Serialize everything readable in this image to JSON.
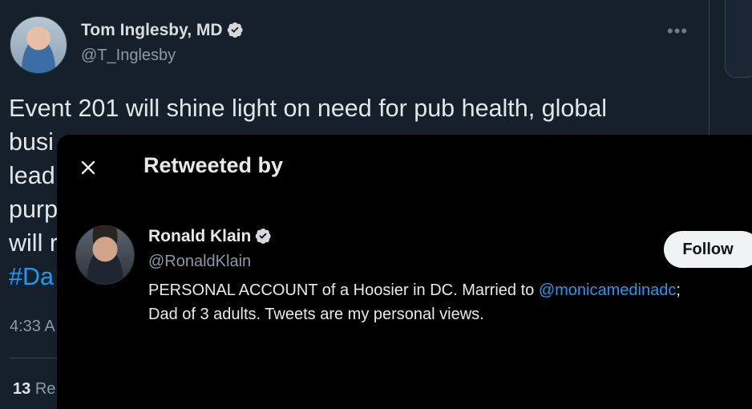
{
  "tweet": {
    "author_name": "Tom Inglesby, MD",
    "author_handle": "@T_Inglesby",
    "text_lines": [
      "Event 201 will shine light on need for pub health, global",
      "busi",
      "lead",
      "purp",
      "will r"
    ],
    "hashtag_visible": "#Da",
    "timestamp_visible": "4:33 A",
    "retweet_count": "13",
    "retweet_label_visible": "Re"
  },
  "modal": {
    "title": "Retweeted by",
    "user": {
      "name": "Ronald Klain",
      "handle": "@RonaldKlain",
      "bio_prefix": "PERSONAL ACCOUNT of a Hoosier in DC. Married to ",
      "bio_mention": "@monicamedinadc",
      "bio_suffix": ";",
      "bio_line2": "Dad of 3 adults. Tweets are my personal views.",
      "follow_label": "Follow"
    }
  },
  "icons": {
    "verified": "verified-badge-icon",
    "close": "close-icon",
    "more": "more-icon"
  },
  "colors": {
    "background": "#15202b",
    "modal_background": "#000000",
    "accent": "#1d9bf0",
    "verified_badge": "#d6d9db"
  }
}
